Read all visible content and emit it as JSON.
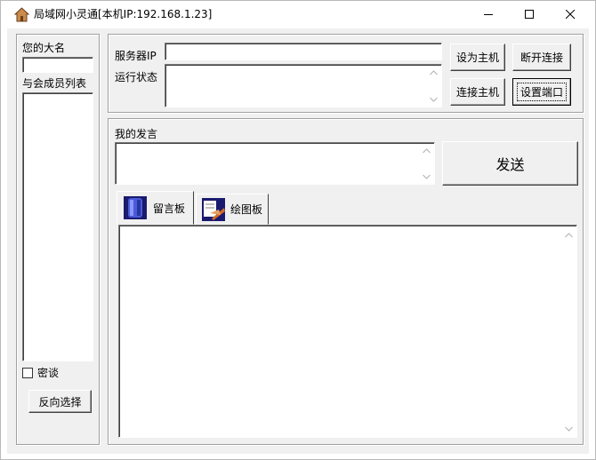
{
  "window": {
    "title": "局域网小灵通[本机IP:192.168.1.23]",
    "minimize_icon": "minimize-icon",
    "maximize_icon": "maximize-icon",
    "close_icon": "close-icon",
    "app_icon": "house-icon"
  },
  "left_panel": {
    "name_label": "您的大名",
    "name_value": "",
    "members_label": "与会成员列表",
    "members": [],
    "secret_checkbox_label": "密谈",
    "secret_checked": false,
    "invert_button": "反向选择"
  },
  "server": {
    "ip_label": "服务器IP",
    "ip_value": "",
    "status_label": "运行状态",
    "status_value": "",
    "set_host_button": "设为主机",
    "disconnect_button": "断开连接",
    "connect_host_button": "连接主机",
    "set_port_button": "设置端口"
  },
  "chat": {
    "my_message_label": "我的发言",
    "message_value": "",
    "send_button": "发送",
    "tabs": [
      {
        "label": "留言板",
        "icon": "message-board-icon",
        "active": true
      },
      {
        "label": "绘图板",
        "icon": "drawing-board-icon",
        "active": false
      }
    ],
    "board_content": ""
  },
  "colors": {
    "window_bg": "#f0f0f0",
    "field_bg": "#ffffff",
    "border_dark": "#a0a0a0"
  }
}
